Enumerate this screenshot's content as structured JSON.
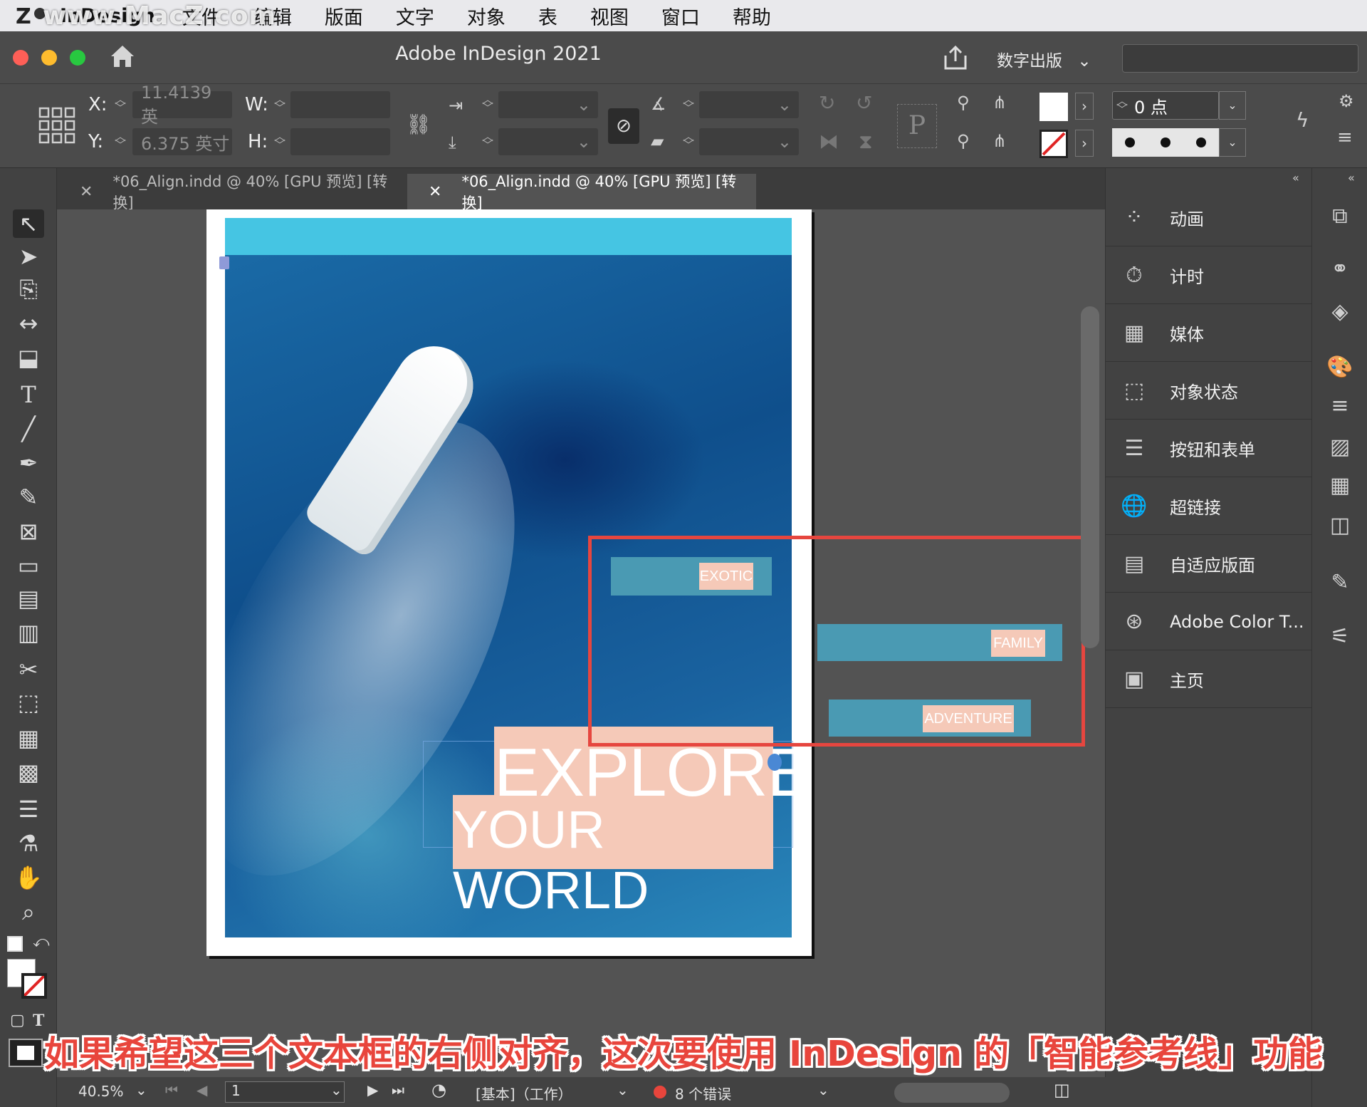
{
  "menubar": {
    "app_name": "InDesign",
    "watermark": "www.MacZ.com",
    "items": [
      "文件",
      "编辑",
      "版面",
      "文字",
      "对象",
      "表",
      "视图",
      "窗口",
      "帮助"
    ]
  },
  "titlebar": {
    "title": "Adobe InDesign 2021",
    "workspace": "数字出版"
  },
  "control": {
    "x_label": "X:",
    "x_value": "11.4139 英",
    "y_label": "Y:",
    "y_value": "6.375 英寸",
    "w_label": "W:",
    "h_label": "H:",
    "stroke_weight": "0 点",
    "reference_point_char": "P"
  },
  "tabs": [
    {
      "label": "*06_Align.indd @ 40% [GPU 预览] [转换]",
      "active": false
    },
    {
      "label": "*06_Align.indd @ 40% [GPU 预览] [转换]",
      "active": true
    }
  ],
  "document": {
    "headline1": "EXPLORE",
    "headline2": "YOUR WORLD",
    "tags": [
      "EXOTIC",
      "FAMILY",
      "ADVENTURE"
    ],
    "highlight_color": "#e6463f",
    "peach_color": "#f5c9b8",
    "teal_color": "#4a9ab3",
    "cyan_color": "#45c5e3"
  },
  "right_panel": {
    "items": [
      {
        "label": "动画",
        "icon": "animation-icon"
      },
      {
        "label": "计时",
        "icon": "timing-icon"
      },
      {
        "label": "媒体",
        "icon": "media-icon"
      },
      {
        "label": "对象状态",
        "icon": "object-states-icon"
      },
      {
        "label": "按钮和表单",
        "icon": "buttons-forms-icon"
      },
      {
        "label": "超链接",
        "icon": "hyperlinks-icon"
      },
      {
        "label": "自适应版面",
        "icon": "liquid-layout-icon"
      },
      {
        "label": "Adobe Color T...",
        "icon": "adobe-color-icon"
      },
      {
        "label": "主页",
        "icon": "pages-icon"
      }
    ]
  },
  "status": {
    "zoom": "40.5%",
    "page": "1",
    "profile": "[基本]（工作）",
    "errors": "8 个错误",
    "error_color": "#e8453c"
  },
  "subtitle": "如果希望这三个文本框的右侧对齐，这次要使用 InDesign 的「智能参考线」功能"
}
